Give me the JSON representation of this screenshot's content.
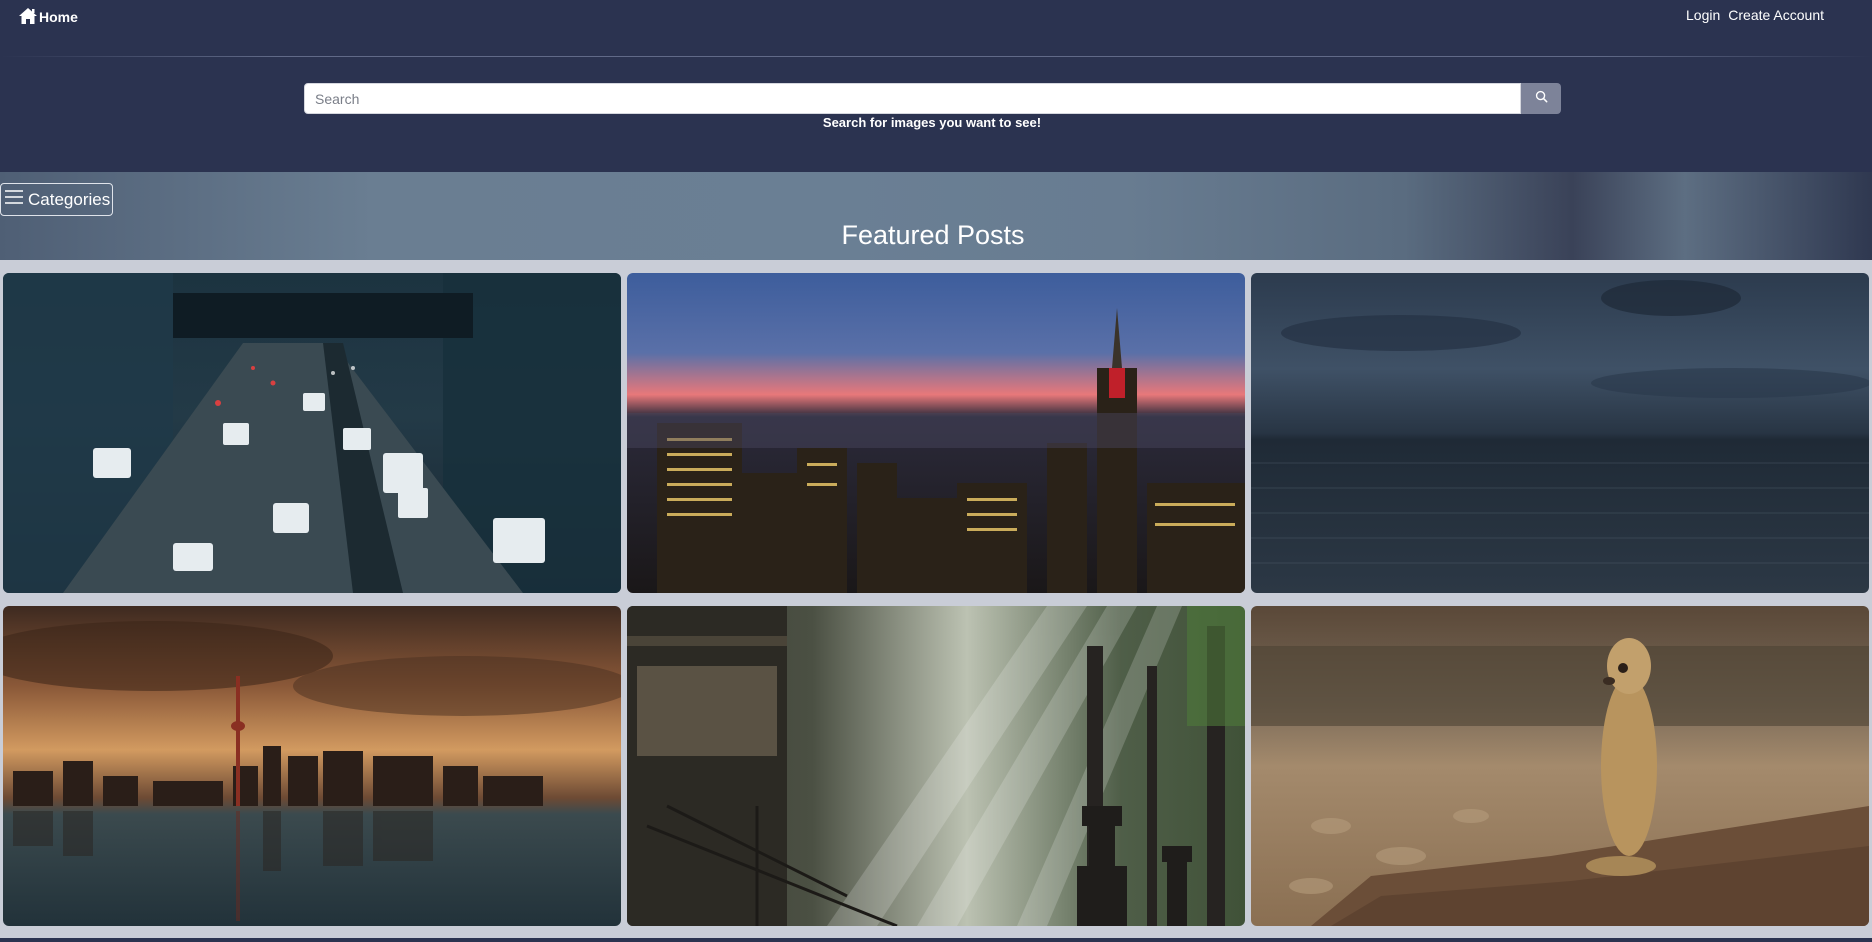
{
  "nav": {
    "home_label": "Home",
    "home_icon": "home-icon",
    "login_label": "Login",
    "create_account_label": "Create Account"
  },
  "search": {
    "placeholder": "Search",
    "value": "",
    "button_icon": "search-icon",
    "hint": "Search for images you want to see!"
  },
  "categories": {
    "label": "Categories",
    "icon": "hamburger-menu-icon"
  },
  "featured": {
    "title": "Featured Posts",
    "posts": [
      {
        "subject": "city-highway-traffic"
      },
      {
        "subject": "city-skyline-dusk"
      },
      {
        "subject": "stormy-ocean"
      },
      {
        "subject": "waterfront-skyline-reflection"
      },
      {
        "subject": "forest-temple-sunbeams"
      },
      {
        "subject": "meerkat-on-rock"
      }
    ]
  },
  "colors": {
    "header_bg": "#2b3350",
    "search_button_bg": "#7d8399",
    "page_bg": "#c9cdd7"
  }
}
